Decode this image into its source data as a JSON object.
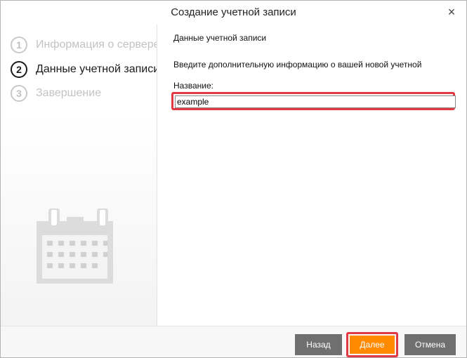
{
  "window": {
    "title": "Создание учетной записи",
    "close_glyph": "×"
  },
  "steps": [
    {
      "number": "1",
      "label": "Информация о сервере",
      "state": "inactive"
    },
    {
      "number": "2",
      "label": "Данные учетной записи",
      "state": "active"
    },
    {
      "number": "3",
      "label": "Завершение",
      "state": "inactive"
    }
  ],
  "sidebar": {
    "illustration_icon": "calendar-icon"
  },
  "content": {
    "section_title": "Данные учетной записи",
    "description": "Введите дополнительную информацию о вашей новой учетной",
    "name_label": "Название:",
    "name_value": "example"
  },
  "buttons": {
    "back": "Назад",
    "next": "Далее",
    "cancel": "Отмена"
  },
  "colors": {
    "accent": "#ff8a00",
    "highlight": "#e13a44",
    "secondary_button": "#6f6f6f"
  }
}
